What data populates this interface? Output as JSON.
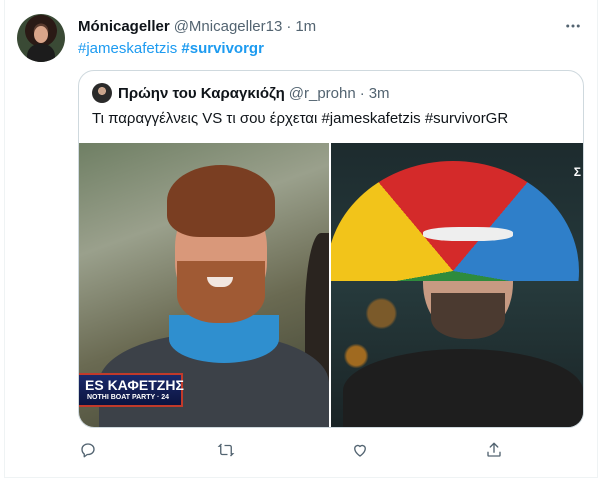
{
  "tweet": {
    "author_name": "Mónicageller",
    "author_handle": "@Mnicageller13",
    "separator": "·",
    "time": "1m",
    "hashtag_1": "#jameskafetzis",
    "hashtag_2": "#survivorgr"
  },
  "quoted_tweet": {
    "author_name": "Πρώην του Καραγκιόζη",
    "author_handle": "@r_prohn",
    "separator": "·",
    "time": "3m",
    "text": "Τι παραγγέλνεις VS τι σου έρχεται #jameskafetzis #survivorGR",
    "media": {
      "left_banner_line1": "ES ΚΑΦΕΤΖΗΣ",
      "left_banner_line2": "ΝΟΤΗΙ BOAT PARTY · 24",
      "right_corner_text": "Σ"
    }
  },
  "icons": {
    "more": "more-icon",
    "reply": "reply-icon",
    "retweet": "retweet-icon",
    "like": "like-icon",
    "share": "share-icon"
  },
  "colors": {
    "link": "#1d9bf0",
    "secondary_text": "#536471",
    "border": "#cfd9de"
  }
}
